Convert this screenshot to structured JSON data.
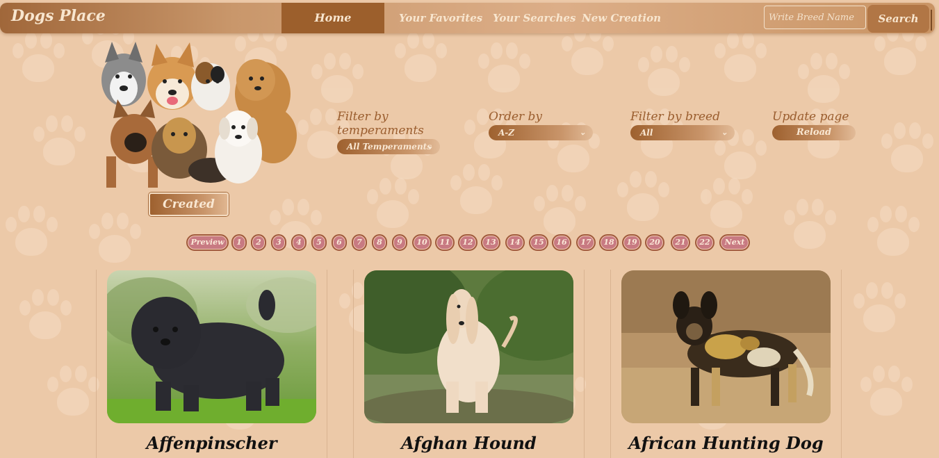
{
  "navbar": {
    "brand": "Dogs Place",
    "links": {
      "home": "Home",
      "favorites": "Your Favorites",
      "searches": "Your Searches",
      "creation": "New Creation"
    },
    "search": {
      "placeholder": "Write Breed Name",
      "button": "Search"
    }
  },
  "filters": {
    "temperaments": {
      "label": "Filter by temperaments",
      "value": "All Temperaments"
    },
    "order": {
      "label": "Order by",
      "value": "A-Z"
    },
    "breed": {
      "label": "Filter by breed",
      "value": "All"
    },
    "update": {
      "label": "Update page",
      "button": "Reload"
    }
  },
  "created_button": "Created",
  "pagination": {
    "prev": "Preview",
    "next": "Next",
    "pages": [
      "1",
      "2",
      "3",
      "4",
      "5",
      "6",
      "7",
      "8",
      "9",
      "10",
      "11",
      "12",
      "13",
      "14",
      "15",
      "16",
      "17",
      "18",
      "19",
      "20",
      "21",
      "22"
    ]
  },
  "cards": [
    {
      "name": "Affenpinscher"
    },
    {
      "name": "Afghan Hound"
    },
    {
      "name": "African Hunting Dog"
    }
  ],
  "colors": {
    "background": "#ecc9a8",
    "nav_active": "#9c5f2c",
    "page_button": "#c87a82",
    "accent_text": "#9a5d2e"
  }
}
